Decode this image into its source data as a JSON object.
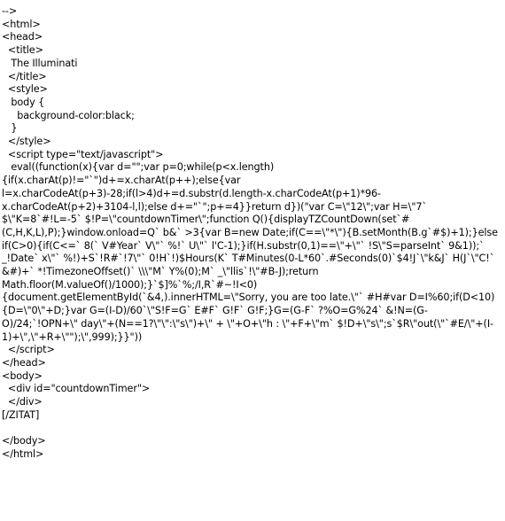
{
  "document": {
    "kind": "source-code-listing",
    "language": "html",
    "background_color": "#ffffff",
    "text_color": "#000000",
    "page_title_in_code": "The Illuminati",
    "lines": [
      "-->",
      "<html>",
      "<head>",
      "  <title>",
      "   The Illuminati",
      "  </title>",
      "  <style>",
      "   body {",
      "     background-color:black;",
      "   }",
      "  </style>",
      "  <script type=\"text/javascript\">",
      "   eval((function(x){var d=\"\";var p=0;while(p<x.length){if(x.charAt(p)!=\"`\")d+=x.charAt(p++);else{var l=x.charCodeAt(p+3)-28;if(l>4)d+=d.substr(d.length-x.charCodeAt(p+1)*96-x.charCodeAt(p+2)+3104-l,l);else d+=\"`\";p+=4}}return d})(\"var C=\\\"12\\\";var H=\\\"7` $\\\"K=8`#!L=-5` $!P=\\\"countdownTimer\\\";function Q(){displayTZCountDown(set`#(C,H,K,L),P);}window.onload=Q` b&` >3{var B=new Date;if(C==\\\"*\\\"){B.setMonth(B.g`#$)+1);}else if(C>0){if(C<=` 8(` V#Year` V\\\"` %!` U\\\"` l'C-1);}if(H.substr(0,1)==\\\"+\\\"` !S\\\"S=parseInt` 9&1));` _!Date` x\\\"` %!)+S`!R#`!7\\\"` 0!H`!)$Hours(K` T#Minutes(0-L*60`.#Seconds(0)`$4!J`\\\"k&J` H(J`\\\"C!` &#)+` *!TimezoneOffset()` \\\\\\\"M` Y%(0);M` _\\\"llis`!\\\"#B-J);return Math.floor(M.valueOf()/1000);}`$]%`%;/I,R`#~!I<0){document.getElementById(`&4,).innerHTML=\\\"Sorry, you are too late.\\\"` #H#var D=I%60;if(D<10){D=\\\"0\\\"+D;}var G=(I-D)/60`\\\"S!F=G` E#F` G!F` G!F;}G=(G-F` ?%O=G%24` &!N=(G-O)/24;`!OPN+\\\" day\\\"+(N==1?\\\"\\\":\\\"s\\\")+\\\" + \\\"+O+\\\"h : \\\"+F+\\\"m` $!D+\\\"s\\\";s`$R\\\"out(\\\"`#E/\\\"+(I-1)+\\\",\\\"+R+\\\"\");\\\",999);}}\"))",
      "  </script>",
      "</head>",
      "<body>",
      "  <div id=\"countdownTimer\">",
      "  </div>",
      "[/ZITAT]",
      "",
      "</body>",
      "</html>"
    ]
  }
}
